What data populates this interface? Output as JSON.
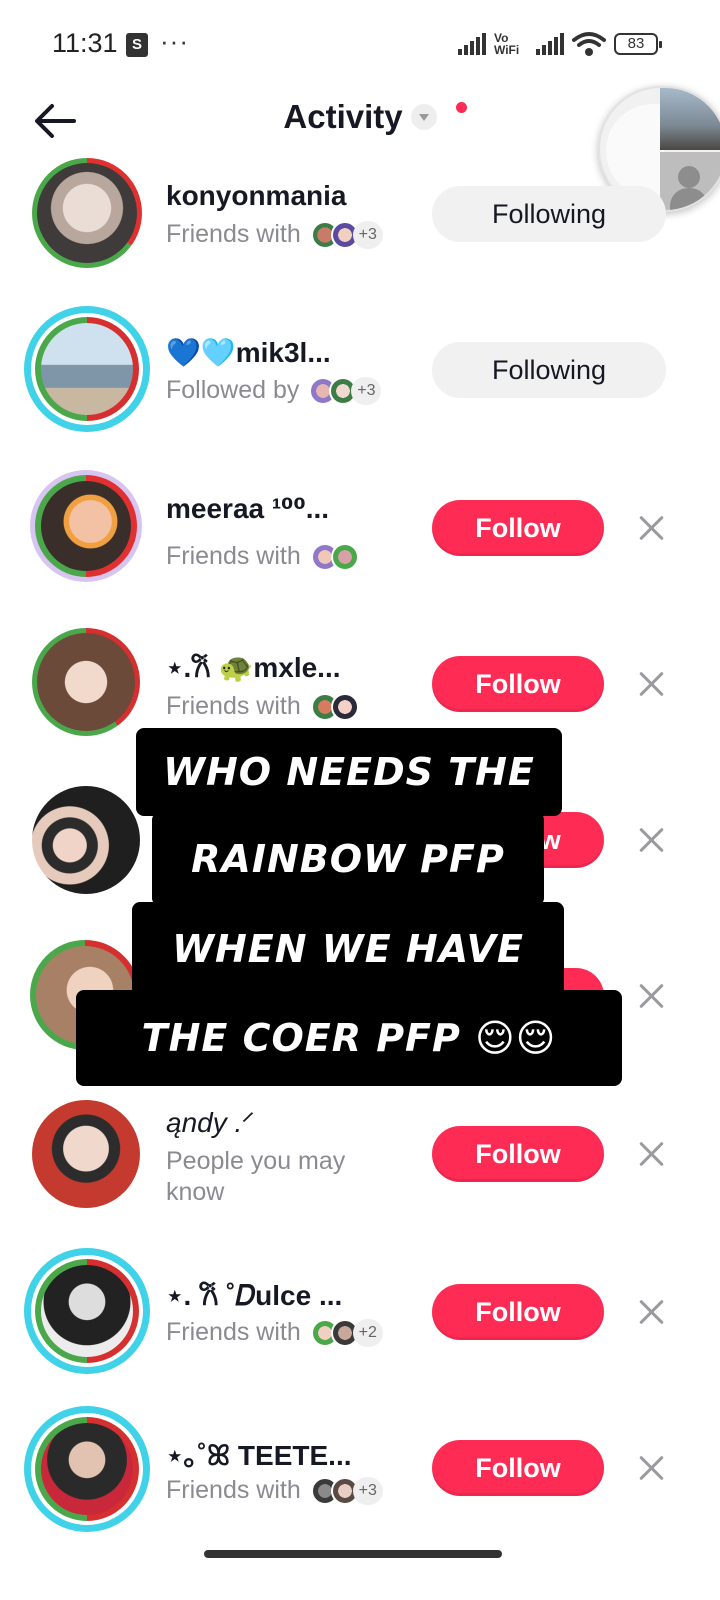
{
  "status_bar": {
    "time": "11:31",
    "notif_icon": "shopping-bag-icon",
    "more": "···",
    "vowifi": "Vo WiFi",
    "battery": "83"
  },
  "header": {
    "title": "Activity"
  },
  "list": [
    {
      "username": "konyonmania",
      "subtitle": "Friends with",
      "mutual_extra": "+3",
      "button": "Following",
      "state": "following"
    },
    {
      "username": "💙🩵mik3l...",
      "subtitle": "Followed by",
      "mutual_extra": "+3",
      "button": "Following",
      "state": "following"
    },
    {
      "username": "meeraa ¹⁰⁰...",
      "subtitle": "Friends with",
      "mutual_extra": "",
      "button": "Follow",
      "state": "follow"
    },
    {
      "username": "⋆.𐙚 🐢mxle...",
      "subtitle": "Friends with",
      "mutual_extra": "",
      "button": "Follow",
      "state": "follow"
    },
    {
      "username": "",
      "subtitle": "",
      "mutual_extra": "",
      "button": "Follow",
      "state": "follow"
    },
    {
      "username": "",
      "subtitle": "",
      "mutual_extra": "",
      "button": "Follow",
      "state": "follow"
    },
    {
      "username": "ąndy .ᐟ",
      "subtitle": "People you may know",
      "mutual_extra": "",
      "button": "Follow",
      "state": "follow"
    },
    {
      "username": "⋆. 𐙚 ˚𝐷ulce ...",
      "subtitle": "Friends with",
      "mutual_extra": "+2",
      "button": "Follow",
      "state": "follow"
    },
    {
      "username": "⋆｡˚ꕤ TEETE...",
      "subtitle": "Friends with",
      "mutual_extra": "+3",
      "button": "Follow",
      "state": "follow"
    }
  ],
  "overlay_caption": {
    "line1": "WHO NEEDS THE",
    "line2": "RAINBOW PFP",
    "line3": "WHEN WE HAVE",
    "line4": "THE COER PFP 😌😌"
  },
  "colors": {
    "accent": "#fe2c55",
    "following_bg": "#f1f1f2",
    "text_primary": "#161823",
    "text_secondary": "#8a8b91"
  }
}
